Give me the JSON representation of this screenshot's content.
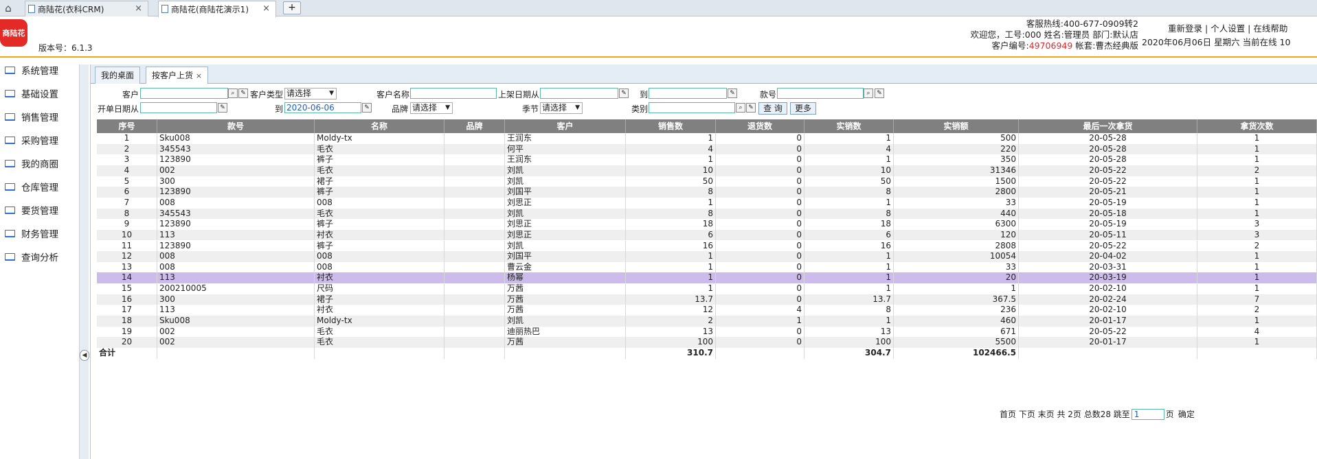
{
  "browser_tabs": [
    {
      "label": "商陆花(衣科CRM)",
      "active": false
    },
    {
      "label": "商陆花(商陆花演示1)",
      "active": true
    }
  ],
  "new_tab_label": "+",
  "header": {
    "logo_text": "商陆花",
    "version": "版本号：6.1.3",
    "hotline": "客服热线:400-677-0909转2",
    "welcome": "欢迎您，工号:000 姓名:管理员 部门:默认店",
    "customer_no_label": "客户编号:",
    "customer_no": "49706949",
    "account": " 帐套:曹杰经典版",
    "relogin": "重新登录",
    "personal": "个人设置",
    "help": "在线帮助",
    "sep": " | ",
    "date_line": "2020年06月06日 星期六 当前在线 10"
  },
  "sidebar": {
    "items": [
      {
        "label": "系统管理"
      },
      {
        "label": "基础设置"
      },
      {
        "label": "销售管理"
      },
      {
        "label": "采购管理"
      },
      {
        "label": "我的商圈"
      },
      {
        "label": "仓库管理"
      },
      {
        "label": "要货管理"
      },
      {
        "label": "财务管理"
      },
      {
        "label": "查询分析"
      }
    ]
  },
  "inner_tabs": [
    {
      "label": "我的桌面"
    },
    {
      "label": "按客户上货"
    }
  ],
  "inner_tab_close": "×",
  "filters": {
    "customer_label": "客户",
    "customer_type_label": "客户类型",
    "customer_type_value": "请选择",
    "customer_name_label": "客户名称",
    "shelf_date_from_label": "上架日期从",
    "to_label": "到",
    "style_no_label": "款号",
    "order_date_from_label": "开单日期从",
    "order_date_to_value": "2020-06-06",
    "brand_label": "品牌",
    "brand_value": "请选择",
    "season_label": "季节",
    "season_value": "请选择",
    "category_label": "类别",
    "query_button": "查 询",
    "more_button": "更多"
  },
  "table": {
    "columns": [
      "序号",
      "款号",
      "名称",
      "品牌",
      "客户",
      "销售数",
      "退货数",
      "实销数",
      "实销额",
      "最后一次拿货",
      "拿货次数"
    ],
    "rows": [
      [
        "1",
        "Sku008",
        "Moldy-tx",
        "",
        "王润东",
        "1",
        "0",
        "1",
        "500",
        "20-05-28",
        "1"
      ],
      [
        "2",
        "345543",
        "毛衣",
        "",
        "何平",
        "4",
        "0",
        "4",
        "220",
        "20-05-28",
        "1"
      ],
      [
        "3",
        "123890",
        "裤子",
        "",
        "王润东",
        "1",
        "0",
        "1",
        "350",
        "20-05-28",
        "1"
      ],
      [
        "4",
        "002",
        "毛衣",
        "",
        "刘凯",
        "10",
        "0",
        "10",
        "31346",
        "20-05-22",
        "2"
      ],
      [
        "5",
        "300",
        "裙子",
        "",
        "刘凯",
        "50",
        "0",
        "50",
        "1500",
        "20-05-22",
        "1"
      ],
      [
        "6",
        "123890",
        "裤子",
        "",
        "刘国平",
        "8",
        "0",
        "8",
        "2800",
        "20-05-21",
        "1"
      ],
      [
        "7",
        "008",
        "008",
        "",
        "刘思正",
        "1",
        "0",
        "1",
        "33",
        "20-05-19",
        "1"
      ],
      [
        "8",
        "345543",
        "毛衣",
        "",
        "刘凯",
        "8",
        "0",
        "8",
        "440",
        "20-05-18",
        "1"
      ],
      [
        "9",
        "123890",
        "裤子",
        "",
        "刘思正",
        "18",
        "0",
        "18",
        "6300",
        "20-05-19",
        "3"
      ],
      [
        "10",
        "113",
        "衬衣",
        "",
        "刘思正",
        "6",
        "0",
        "6",
        "120",
        "20-05-11",
        "3"
      ],
      [
        "11",
        "123890",
        "裤子",
        "",
        "刘凯",
        "16",
        "0",
        "16",
        "2808",
        "20-05-22",
        "2"
      ],
      [
        "12",
        "008",
        "008",
        "",
        "刘国平",
        "1",
        "0",
        "1",
        "10054",
        "20-04-02",
        "1"
      ],
      [
        "13",
        "008",
        "008",
        "",
        "曹云金",
        "1",
        "0",
        "1",
        "33",
        "20-03-31",
        "1"
      ],
      [
        "14",
        "113",
        "衬衣",
        "",
        "杨幂",
        "1",
        "0",
        "1",
        "20",
        "20-03-19",
        "1"
      ],
      [
        "15",
        "200210005",
        "尺码",
        "",
        "万茜",
        "1",
        "0",
        "1",
        "1",
        "20-02-10",
        "1"
      ],
      [
        "16",
        "300",
        "裙子",
        "",
        "万茜",
        "13.7",
        "0",
        "13.7",
        "367.5",
        "20-02-24",
        "7"
      ],
      [
        "17",
        "113",
        "衬衣",
        "",
        "万茜",
        "12",
        "4",
        "8",
        "236",
        "20-02-10",
        "2"
      ],
      [
        "18",
        "Sku008",
        "Moldy-tx",
        "",
        "刘凯",
        "2",
        "1",
        "1",
        "460",
        "20-01-17",
        "1"
      ],
      [
        "19",
        "002",
        "毛衣",
        "",
        "迪丽热巴",
        "13",
        "0",
        "13",
        "671",
        "20-05-22",
        "4"
      ],
      [
        "20",
        "002",
        "毛衣",
        "",
        "万茜",
        "100",
        "0",
        "100",
        "5500",
        "20-01-17",
        "1"
      ]
    ],
    "selected_row": 14,
    "total": {
      "label": "合计",
      "sales": "310.7",
      "actual_qty": "304.7",
      "actual_amount": "102466.5"
    }
  },
  "pager": {
    "text": "首页 下页 末页 共 2页 总数28 跳至",
    "page_value": "1",
    "suffix": "页",
    "confirm": "确定"
  },
  "colors": {
    "accent_orange": "#f1a71c",
    "header_gray": "#808080",
    "selected_row": "#ccbcec",
    "red_text": "#e0282a"
  }
}
